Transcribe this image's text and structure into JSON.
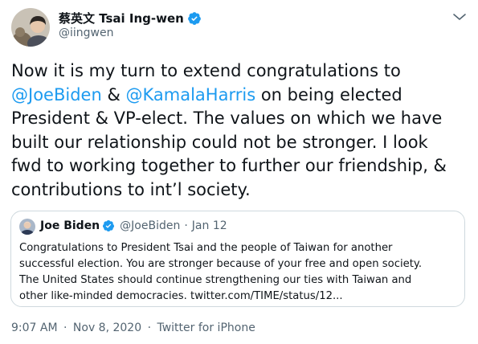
{
  "author": {
    "name": "蔡英文 Tsai Ing-wen",
    "handle": "@iingwen",
    "avatar_icon": "avatar-photo-icon",
    "verified_icon": "verified-badge-icon"
  },
  "more_icon": "more-options-icon",
  "tweet": {
    "lines": [
      [
        {
          "text": "Now it is my turn to extend congratulations to",
          "mention": false
        }
      ],
      [
        {
          "text": "@JoeBiden",
          "mention": true
        },
        {
          "text": " & ",
          "mention": false
        },
        {
          "text": "@KamalaHarris",
          "mention": true
        },
        {
          "text": " on being elected",
          "mention": false
        }
      ],
      [
        {
          "text": "President & VP-elect. The values on which we have",
          "mention": false
        }
      ],
      [
        {
          "text": "built our relationship could not be stronger. I look",
          "mention": false
        }
      ],
      [
        {
          "text": "fwd to working together to further our friendship, &",
          "mention": false
        }
      ],
      [
        {
          "text": "contributions to int’l society.",
          "mention": false
        }
      ]
    ]
  },
  "quote": {
    "name": "Joe Biden",
    "handle": "@JoeBiden",
    "separator": "·",
    "date": "Jan 12",
    "lines": [
      "Congratulations to President Tsai and the people of Taiwan for another",
      "successful election. You are stronger because of your free and open society.",
      "The United States should continue strengthening our ties with Taiwan and",
      "other like-minded democracies. twitter.com/TIME/status/12..."
    ]
  },
  "footer": {
    "time": "9:07 AM",
    "date": "Nov 8, 2020",
    "separator": "·",
    "source": "Twitter for iPhone"
  },
  "colors": {
    "link": "#1d9bf0",
    "text": "#0f1419",
    "muted": "#536471",
    "border": "#cfd9de",
    "verified": "#1d9bf0"
  }
}
